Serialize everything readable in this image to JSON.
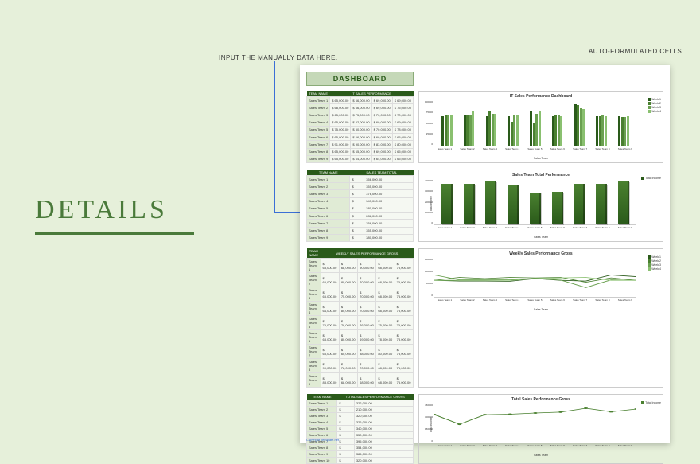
{
  "details_label": "DETAILS",
  "annotations": {
    "input": "INPUT THE MANUALLY DATA HERE.",
    "auto": "AUTO-FORMULATED CELLS."
  },
  "dashboard_title": "DASHBOARD",
  "footer": "Copyright Template.net",
  "tables": {
    "it_sales": {
      "headers": [
        "TEAM NAME",
        "IT SALES PERFORMANCE"
      ],
      "cols": [
        "",
        "",
        "",
        "",
        ""
      ],
      "rows": [
        [
          "Sales Team 1",
          "$ 65,000.00",
          "$ 66,000.00",
          "$ 69,000.00",
          "$ 69,000.00"
        ],
        [
          "Sales Team 2",
          "$ 68,000.00",
          "$ 66,000.00",
          "$ 69,000.00",
          "$ 75,000.00"
        ],
        [
          "Sales Team 3",
          "$ 65,000.00",
          "$ 75,000.00",
          "$ 70,000.00",
          "$ 70,000.00"
        ],
        [
          "Sales Team 4",
          "$ 65,000.00",
          "$ 52,000.00",
          "$ 69,000.00",
          "$ 69,000.00"
        ],
        [
          "Sales Team 5",
          "$ 75,000.00",
          "$ 50,000.00",
          "$ 70,000.00",
          "$ 78,000.00"
        ],
        [
          "Sales Team 6",
          "$ 65,000.00",
          "$ 66,000.00",
          "$ 69,000.00",
          "$ 65,000.00"
        ],
        [
          "Sales Team 7",
          "$ 91,000.00",
          "$ 90,000.00",
          "$ 83,000.00",
          "$ 80,000.00"
        ],
        [
          "Sales Team 8",
          "$ 65,000.00",
          "$ 65,000.00",
          "$ 69,000.00",
          "$ 65,000.00"
        ],
        [
          "Sales Team 9",
          "$ 65,000.00",
          "$ 64,000.00",
          "$ 64,000.00",
          "$ 65,000.00"
        ]
      ]
    },
    "sales_total": {
      "headers": [
        "TEAM NAME",
        "SALES TEAM TOTAL"
      ],
      "rows": [
        [
          "Sales Team 1",
          "$",
          "356,000.00"
        ],
        [
          "Sales Team 2",
          "$",
          "355,000.00"
        ],
        [
          "Sales Team 3",
          "$",
          "376,000.00"
        ],
        [
          "Sales Team 4",
          "$",
          "343,000.00"
        ],
        [
          "Sales Team 5",
          "$",
          "280,000.00"
        ],
        [
          "Sales Team 6",
          "$",
          "288,000.00"
        ],
        [
          "Sales Team 7",
          "$",
          "356,000.00"
        ],
        [
          "Sales Team 8",
          "$",
          "355,000.00"
        ],
        [
          "Sales Team 9",
          "$",
          "380,000.00"
        ]
      ]
    },
    "weekly_gross": {
      "headers": [
        "TEAM NAME",
        "WEEKLY SALES PERFORMANCE GROSS"
      ],
      "rows": [
        [
          "Sales Team 1",
          "$ 68,000.00",
          "$ 68,000.00",
          "$ 90,000.00",
          "$ 68,000.00",
          "$ 75,000.00"
        ],
        [
          "Sales Team 2",
          "$ 65,000.00",
          "$ 80,000.00",
          "$ 70,000.00",
          "$ 68,000.00",
          "$ 75,000.00"
        ],
        [
          "Sales Team 3",
          "$ 65,000.00",
          "$ 75,000.00",
          "$ 70,000.00",
          "$ 68,000.00",
          "$ 75,000.00"
        ],
        [
          "Sales Team 4",
          "$ 64,000.00",
          "$ 80,000.00",
          "$ 70,000.00",
          "$ 68,000.00",
          "$ 75,000.00"
        ],
        [
          "Sales Team 5",
          "$ 75,000.00",
          "$ 78,000.00",
          "$ 76,000.00",
          "$ 75,000.00",
          "$ 75,000.00"
        ],
        [
          "Sales Team 6",
          "$ 68,000.00",
          "$ 80,000.00",
          "$ 69,000.00",
          "$ 78,000.00",
          "$ 78,000.00"
        ],
        [
          "Sales Team 7",
          "$ 65,000.00",
          "$ 60,000.00",
          "$ 38,000.00",
          "$ 80,000.00",
          "$ 78,000.00"
        ],
        [
          "Sales Team 8",
          "$ 90,000.00",
          "$ 78,000.00",
          "$ 70,000.00",
          "$ 68,000.00",
          "$ 75,000.00"
        ],
        [
          "Sales Team 9",
          "$ 83,000.00",
          "$ 68,000.00",
          "$ 68,000.00",
          "$ 68,000.00",
          "$ 75,000.00"
        ]
      ]
    },
    "total_gross": {
      "headers": [
        "TEAM NAME",
        "TOTAL SALES PERFORMANCE GROSS"
      ],
      "rows": [
        [
          "Sales Team 1",
          "$",
          "322,000.00"
        ],
        [
          "Sales Team 2",
          "$",
          "210,000.00"
        ],
        [
          "Sales Team 3",
          "$",
          "320,000.00"
        ],
        [
          "Sales Team 4",
          "$",
          "326,000.00"
        ],
        [
          "Sales Team 5",
          "$",
          "340,000.00"
        ],
        [
          "Sales Team 6",
          "$",
          "350,000.00"
        ],
        [
          "Sales Team 7",
          "$",
          "395,000.00"
        ],
        [
          "Sales Team 8",
          "$",
          "354,000.00"
        ],
        [
          "Sales Team 9",
          "$",
          "386,000.00"
        ],
        [
          "Sales Team 10",
          "$",
          "320,000.00"
        ]
      ]
    }
  },
  "chart_data": [
    {
      "type": "bar",
      "title": "IT Sales Performance Dashboard",
      "xlabel": "Sales Team",
      "ylabel": "",
      "ylim": [
        0,
        100000
      ],
      "yticks": [
        0,
        25000,
        50000,
        75000,
        100000
      ],
      "categories": [
        "Sales Team 1",
        "Sales Team 2",
        "Sales Team 3",
        "Sales Team 4",
        "Sales Team 5",
        "Sales Team 6",
        "Sales Team 7",
        "Sales Team 8",
        "Sales Team 9"
      ],
      "series": [
        {
          "name": "Week 1",
          "color": "#2a5a1a",
          "values": [
            65000,
            68000,
            65000,
            65000,
            75000,
            65000,
            91000,
            65000,
            65000
          ]
        },
        {
          "name": "Week 2",
          "color": "#4a8030",
          "values": [
            66000,
            66000,
            75000,
            52000,
            50000,
            66000,
            90000,
            65000,
            64000
          ]
        },
        {
          "name": "Week 3",
          "color": "#6aa050",
          "values": [
            69000,
            69000,
            70000,
            69000,
            70000,
            69000,
            83000,
            69000,
            64000
          ]
        },
        {
          "name": "Week 4",
          "color": "#8ac070",
          "values": [
            69000,
            75000,
            70000,
            69000,
            78000,
            65000,
            80000,
            65000,
            65000
          ]
        }
      ]
    },
    {
      "type": "bar",
      "title": "Sales Team Total Performance",
      "xlabel": "Sales Team",
      "ylabel": "Total Income",
      "ylim": [
        0,
        400000
      ],
      "yticks": [
        0,
        100000,
        200000,
        300000,
        400000
      ],
      "categories": [
        "Sales Team 1",
        "Sales Team 2",
        "Sales Team 3",
        "Sales Team 4",
        "Sales Team 5",
        "Sales Team 6",
        "Sales Team 7",
        "Sales Team 8",
        "Sales Team 9"
      ],
      "series": [
        {
          "name": "Total Income",
          "color": "#2a5a1a",
          "values": [
            356000,
            355000,
            376000,
            343000,
            280000,
            288000,
            356000,
            355000,
            380000
          ]
        }
      ]
    },
    {
      "type": "line",
      "title": "Weekly Sales Performance Gross",
      "xlabel": "Sales Team",
      "ylabel": "",
      "ylim": [
        0,
        160000
      ],
      "yticks": [
        0,
        50000,
        100000,
        150000
      ],
      "categories": [
        "Sales Team 1",
        "Sales Team 2",
        "Sales Team 3",
        "Sales Team 4",
        "Sales Team 5",
        "Sales Team 6",
        "Sales Team 7",
        "Sales Team 8",
        "Sales Team 9"
      ],
      "series": [
        {
          "name": "Week 1",
          "color": "#2a5a1a",
          "values": [
            68000,
            65000,
            65000,
            64000,
            75000,
            68000,
            65000,
            90000,
            83000
          ]
        },
        {
          "name": "Week 2",
          "color": "#4a8030",
          "values": [
            68000,
            80000,
            75000,
            80000,
            78000,
            80000,
            60000,
            78000,
            68000
          ]
        },
        {
          "name": "Week 3",
          "color": "#6aa050",
          "values": [
            90000,
            70000,
            70000,
            70000,
            76000,
            69000,
            38000,
            70000,
            68000
          ]
        },
        {
          "name": "Week 4",
          "color": "#8ac070",
          "values": [
            68000,
            68000,
            68000,
            68000,
            75000,
            78000,
            80000,
            68000,
            68000
          ]
        }
      ]
    },
    {
      "type": "line",
      "title": "Total Sales Performance Gross",
      "xlabel": "Sales Team",
      "ylabel": "Total Income",
      "ylim": [
        0,
        450000
      ],
      "yticks": [
        0,
        150000,
        300000,
        450000
      ],
      "categories": [
        "Sales Team 1",
        "Sales Team 2",
        "Sales Team 3",
        "Sales Team 4",
        "Sales Team 5",
        "Sales Team 6",
        "Sales Team 7",
        "Sales Team 8",
        "Sales Team 9"
      ],
      "series": [
        {
          "name": "Total Income",
          "color": "#4a8030",
          "values": [
            322000,
            210000,
            320000,
            326000,
            340000,
            350000,
            395000,
            354000,
            386000
          ]
        }
      ]
    }
  ]
}
